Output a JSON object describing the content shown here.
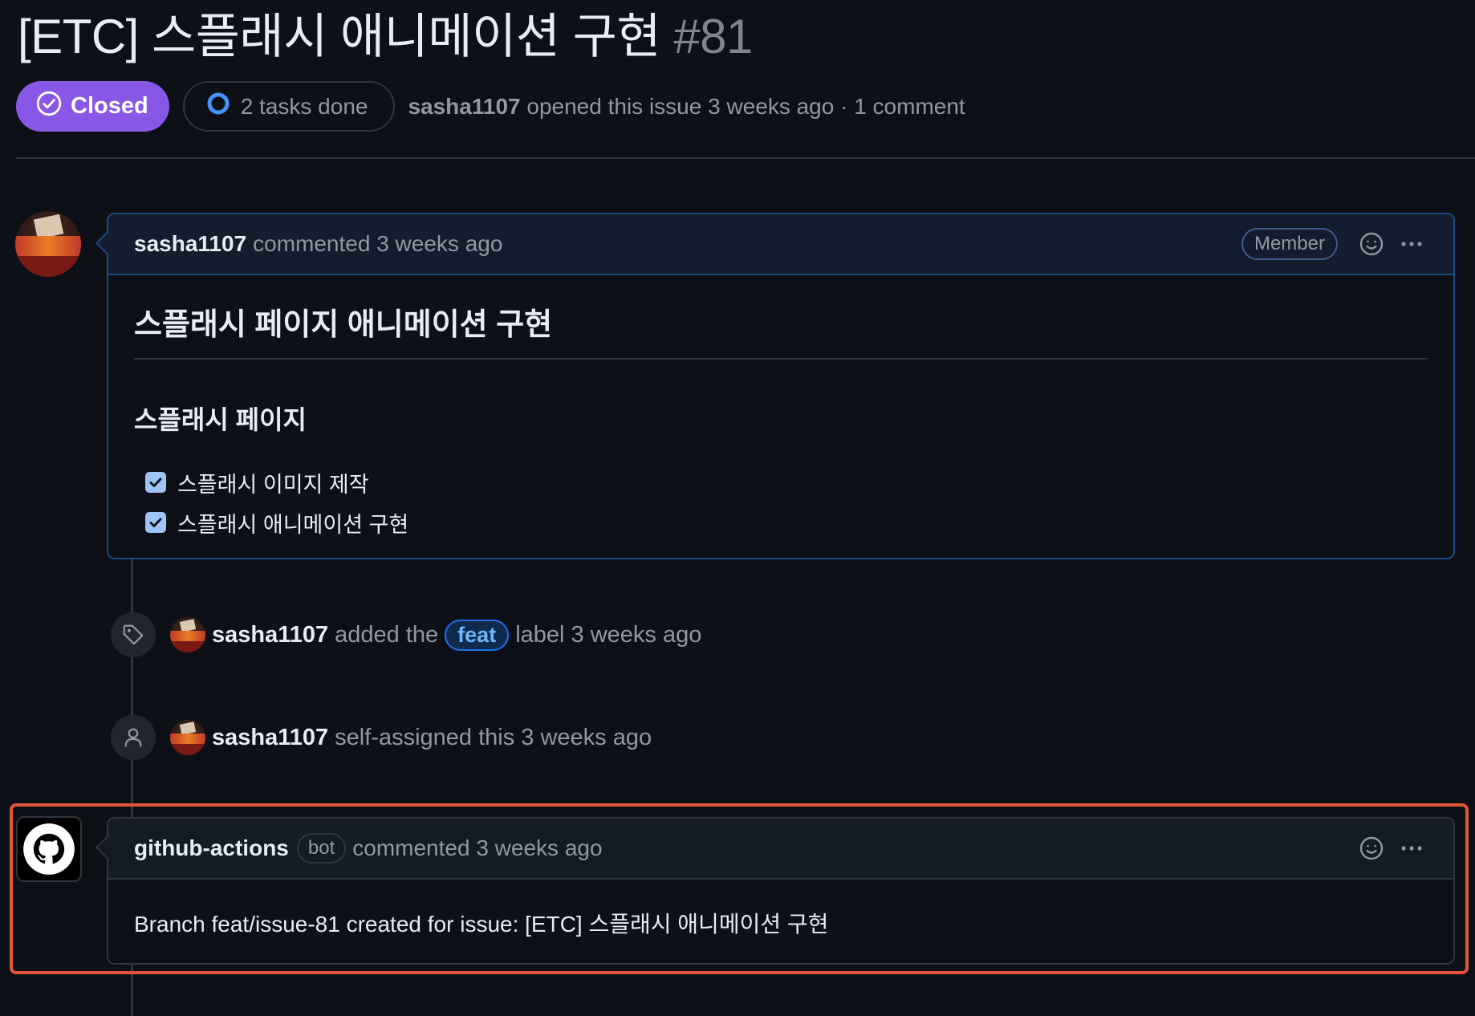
{
  "issue": {
    "title": "[ETC] 스플래시 애니메이션 구현",
    "number": "#81",
    "state_label": "Closed",
    "tasks_label": "2 tasks done",
    "author": "sasha1107",
    "opened_text": "opened this issue 3 weeks ago · 1 comment"
  },
  "colors": {
    "state_closed": "#8957e5",
    "highlight_frame": "#e5533a",
    "label_feat": "#1f6feb"
  },
  "comments": [
    {
      "author": "sasha1107",
      "action": "commented 3 weeks ago",
      "role_badge": "Member",
      "body": {
        "h1": "스플래시 페이지 애니메이션 구현",
        "h2": "스플래시 페이지",
        "tasks": [
          {
            "label": "스플래시 이미지 제작",
            "checked": true
          },
          {
            "label": "스플래시 애니메이션 구현",
            "checked": true
          }
        ]
      }
    },
    {
      "author": "github-actions",
      "bot_badge": "bot",
      "action": "commented 3 weeks ago",
      "body_text": "Branch feat/issue-81 created for issue: [ETC] 스플래시 애니메이션 구현"
    }
  ],
  "events": [
    {
      "icon": "tag-icon",
      "actor": "sasha1107",
      "text_before": "added the",
      "label": "feat",
      "text_after": "label 3 weeks ago"
    },
    {
      "icon": "person-icon",
      "actor": "sasha1107",
      "text": "self-assigned this 3 weeks ago"
    }
  ]
}
